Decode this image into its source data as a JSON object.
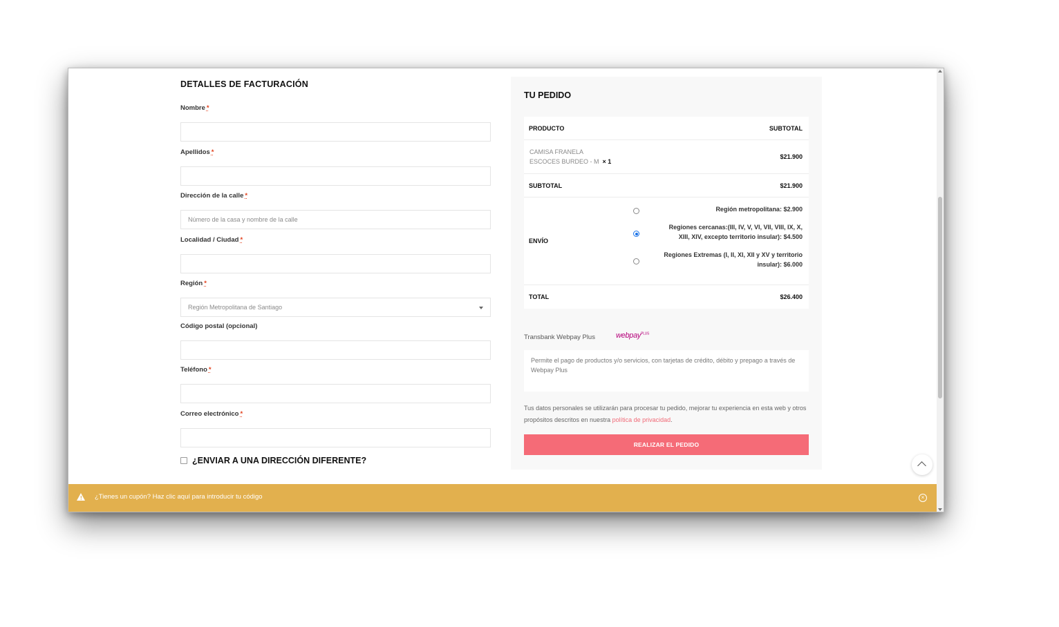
{
  "billing": {
    "title": "DETALLES DE FACTURACIÓN",
    "fields": [
      {
        "label": "Nombre",
        "required": "*",
        "value": ""
      },
      {
        "label": "Apellidos",
        "required": "*",
        "value": ""
      },
      {
        "label": "Dirección de la calle",
        "required": "*",
        "placeholder": "Número de la casa y nombre de la calle"
      },
      {
        "label": "Localidad / Ciudad",
        "required": "*",
        "value": ""
      },
      {
        "label": "Región",
        "required": "*",
        "selected": "Región Metropolitana de Santiago"
      },
      {
        "label": "Código postal (opcional)",
        "value": ""
      },
      {
        "label": "Teléfono",
        "required": "*",
        "value": ""
      },
      {
        "label": "Correo electrónico",
        "required": "*",
        "value": ""
      }
    ],
    "ship_different": "¿ENVIAR A UNA DIRECCIÓN DIFERENTE?"
  },
  "order": {
    "title": "TU PEDIDO",
    "header_product": "PRODUCTO",
    "header_subtotal": "SUBTOTAL",
    "product_line1": "CAMISA FRANELA",
    "product_line2": "ESCOCES BURDEO - M",
    "product_qty": "× 1",
    "product_price": "$21.900",
    "subtotal_label": "SUBTOTAL",
    "subtotal_value": "$21.900",
    "shipping_label": "ENVÍO",
    "shipping_options": [
      {
        "text": "Región metropolitana:",
        "price": "$2.900",
        "checked": false
      },
      {
        "text1": "Regiones cercanas:(III, IV, V, VI, VII, VIII, IX, X,",
        "text2": "XIII, XIV, excepto territorio insular):",
        "price": "$4.500",
        "checked": true
      },
      {
        "text1": "Regiones Extremas (I, II, XI, XII y XV y territorio",
        "text2": "insular):",
        "price": "$6.000",
        "checked": false
      }
    ],
    "total_label": "TOTAL",
    "total_value": "$26.400",
    "payment_method": "Transbank Webpay Plus",
    "payment_logo": "webpay",
    "payment_logo_sup": "PLUS",
    "payment_desc": "Permite el pago de productos y/o servicios, con tarjetas de crédito, débito y prepago a través de Webpay Plus",
    "privacy_text": "Tus datos personales se utilizarán para procesar tu pedido, mejorar tu experiencia en esta web y otros propósitos descritos en nuestra",
    "privacy_link": "política de privacidad",
    "privacy_end": ".",
    "place_order": "REALIZAR EL PEDIDO"
  },
  "coupon": {
    "text": "¿Tienes un cupón? Haz clic aquí para introducir tu código",
    "warn_icon": "warning-icon",
    "close_icon": "close-circle-icon"
  },
  "colors": {
    "accent": "#f56b77",
    "coupon_bar": "#e2b04e",
    "radio_checked": "#1a73e8"
  }
}
